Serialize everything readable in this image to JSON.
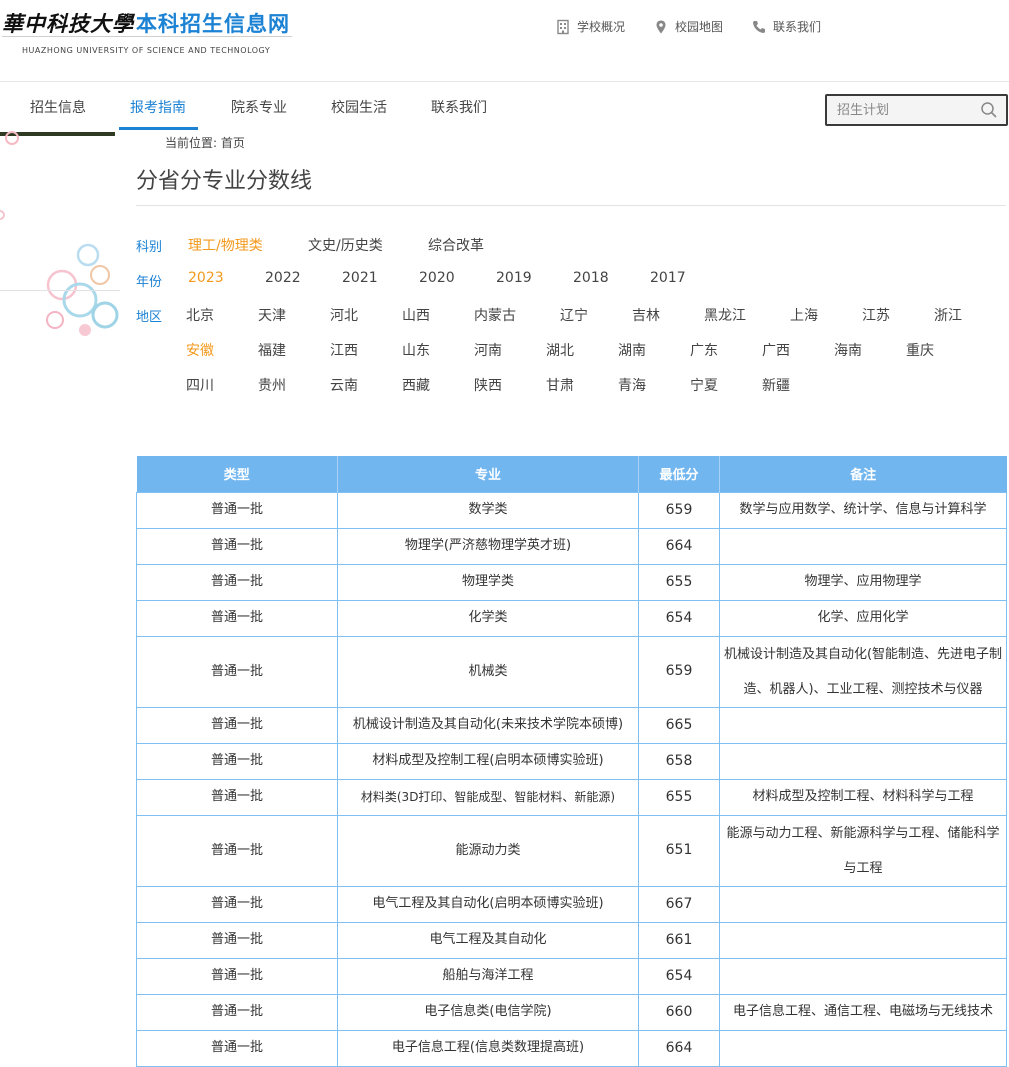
{
  "header": {
    "logo_university": "華中科技大學",
    "logo_site": "本科招生信息网",
    "logo_english": "HUAZHONG UNIVERSITY OF SCIENCE AND TECHNOLOGY",
    "top_links": [
      {
        "label": "学校概况",
        "icon": "building-icon"
      },
      {
        "label": "校园地图",
        "icon": "map-pin-icon"
      },
      {
        "label": "联系我们",
        "icon": "phone-icon"
      }
    ]
  },
  "nav": {
    "items": [
      "招生信息",
      "报考指南",
      "院系专业",
      "校园生活",
      "联系我们"
    ],
    "active_index": 1
  },
  "search": {
    "placeholder": "招生计划"
  },
  "breadcrumb": "当前位置: 首页",
  "page_title": "分省分专业分数线",
  "filters": {
    "category": {
      "label": "科别",
      "options": [
        "理工/物理类",
        "文史/历史类",
        "综合改革"
      ],
      "selected": "理工/物理类"
    },
    "year": {
      "label": "年份",
      "options": [
        "2023",
        "2022",
        "2021",
        "2020",
        "2019",
        "2018",
        "2017"
      ],
      "selected": "2023"
    },
    "region": {
      "label": "地区",
      "rows": [
        [
          "北京",
          "天津",
          "河北",
          "山西",
          "内蒙古",
          "辽宁",
          "吉林",
          "黑龙江",
          "上海",
          "江苏",
          "浙江"
        ],
        [
          "安徽",
          "福建",
          "江西",
          "山东",
          "河南",
          "湖北",
          "湖南",
          "广东",
          "广西",
          "海南",
          "重庆"
        ],
        [
          "四川",
          "贵州",
          "云南",
          "西藏",
          "陕西",
          "甘肃",
          "青海",
          "宁夏",
          "新疆"
        ]
      ],
      "selected": "安徽"
    }
  },
  "table": {
    "headers": [
      "类型",
      "专业",
      "最低分",
      "备注"
    ],
    "rows": [
      {
        "type": "普通一批",
        "major": "数学类",
        "score": "659",
        "note": "数学与应用数学、统计学、信息与计算科学"
      },
      {
        "type": "普通一批",
        "major": "物理学(严济慈物理学英才班)",
        "score": "664",
        "note": ""
      },
      {
        "type": "普通一批",
        "major": "物理学类",
        "score": "655",
        "note": "物理学、应用物理学"
      },
      {
        "type": "普通一批",
        "major": "化学类",
        "score": "654",
        "note": "化学、应用化学"
      },
      {
        "type": "普通一批",
        "major": "机械类",
        "score": "659",
        "note": "机械设计制造及其自动化(智能制造、先进电子制造、机器人)、工业工程、测控技术与仪器"
      },
      {
        "type": "普通一批",
        "major": "机械设计制造及其自动化(未来技术学院本硕博)",
        "score": "665",
        "note": ""
      },
      {
        "type": "普通一批",
        "major": "材料成型及控制工程(启明本硕博实验班)",
        "score": "658",
        "note": ""
      },
      {
        "type": "普通一批",
        "major": "材料类(3D打印、智能成型、智能材料、新能源)",
        "score": "655",
        "note": "材料成型及控制工程、材料科学与工程"
      },
      {
        "type": "普通一批",
        "major": "能源动力类",
        "score": "651",
        "note": "能源与动力工程、新能源科学与工程、储能科学与工程"
      },
      {
        "type": "普通一批",
        "major": "电气工程及其自动化(启明本硕博实验班)",
        "score": "667",
        "note": ""
      },
      {
        "type": "普通一批",
        "major": "电气工程及其自动化",
        "score": "661",
        "note": ""
      },
      {
        "type": "普通一批",
        "major": "船舶与海洋工程",
        "score": "654",
        "note": ""
      },
      {
        "type": "普通一批",
        "major": "电子信息类(电信学院)",
        "score": "660",
        "note": "电子信息工程、通信工程、电磁场与无线技术"
      },
      {
        "type": "普通一批",
        "major": "电子信息工程(信息类数理提高班)",
        "score": "664",
        "note": ""
      }
    ]
  },
  "colors": {
    "accent": "#1c82d4",
    "selected": "#f39a1e",
    "table_header": "#72b6f0"
  }
}
